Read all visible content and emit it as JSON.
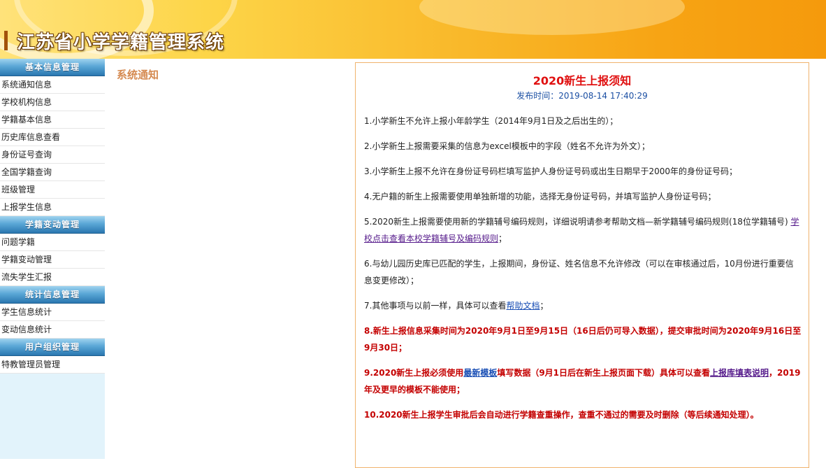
{
  "header": {
    "title": "江苏省小学学籍管理系统"
  },
  "breadcrumb": "系统通知",
  "sidebar": {
    "groups": [
      {
        "title": "基本信息管理",
        "items": [
          "系统通知信息",
          "学校机构信息",
          "学籍基本信息",
          "历史库信息查看",
          "身份证号查询",
          "全国学籍查询",
          "班级管理",
          "上报学生信息"
        ]
      },
      {
        "title": "学籍变动管理",
        "items": [
          "问题学籍",
          "学籍变动管理",
          "流失学生汇报"
        ]
      },
      {
        "title": "统计信息管理",
        "items": [
          "学生信息统计",
          "变动信息统计"
        ]
      },
      {
        "title": "用户组织管理",
        "items": [
          "特教管理员管理"
        ]
      }
    ]
  },
  "notice": {
    "title": "2020新生上报须知",
    "time_label": "发布时间：",
    "time_value": "2019-08-14 17:40:29",
    "p1": "1.小学新生不允许上报小年龄学生（2014年9月1日及之后出生的）；",
    "p2": "2.小学新生上报需要采集的信息为excel模板中的字段（姓名不允许为外文）；",
    "p3": "3.小学新生上报不允许在身份证号码栏填写监护人身份证号码或出生日期早于2000年的身份证号码；",
    "p4": "4.无户籍的新生上报需要使用单独新增的功能，选择无身份证号码，并填写监护人身份证号码；",
    "p5_text": "5.2020新生上报需要使用新的学籍辅号编码规则，详细说明请参考帮助文档—新学籍辅号编码规则(18位学籍辅号) ",
    "p5_link": "学校点击查看本校学籍辅号及编码规则",
    "p5_end": "；",
    "p6": "6.与幼儿园历史库已匹配的学生，上报期间，身份证、姓名信息不允许修改（可以在审核通过后，10月份进行重要信息变更修改）；",
    "p7_text": "7.其他事项与以前一样，具体可以查看",
    "p7_link": "帮助文档",
    "p7_end": "；",
    "p8": "8.新生上报信息采集时间为2020年9月1日至9月15日（16日后仍可导入数据），提交审批时间为2020年9月16日至9月30日；",
    "p9_a": "9.2020新生上报必须使用",
    "p9_link1": "最新模板",
    "p9_b": "填写数据（9月1日后在新生上报页面下载）具体可以查看",
    "p9_link2": "上报库填表说明",
    "p9_c": "，2019年及更早的模板不能使用；",
    "p10": "10.2020新生上报学生审批后会自动进行学籍查重操作，查重不通过的需要及时删除（等后续通知处理）。"
  }
}
